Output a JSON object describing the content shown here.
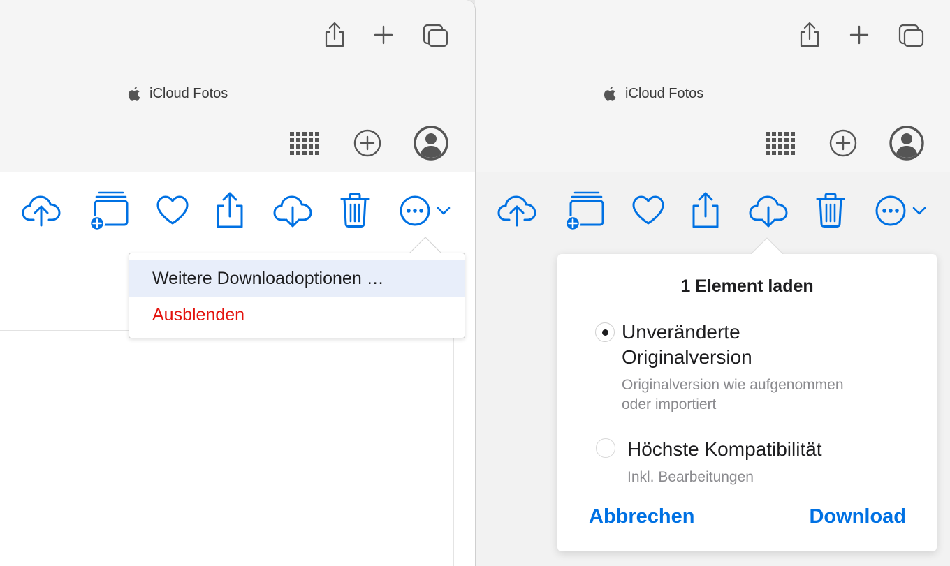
{
  "app": {
    "tab_title": "iCloud Fotos"
  },
  "colors": {
    "accent": "#0071e3",
    "destructive": "#e3130e",
    "icon_gray": "#555555"
  },
  "icons": {
    "titlebar": [
      "share-icon",
      "plus-icon",
      "tabs-overview-icon"
    ],
    "appbar": [
      "app-grid-icon",
      "add-circle-icon",
      "account-avatar-icon"
    ],
    "toolbar": [
      "cloud-upload-icon",
      "add-to-album-icon",
      "heart-icon",
      "share-icon",
      "cloud-download-icon",
      "trash-icon",
      "more-options-icon",
      "chevron-down-icon"
    ]
  },
  "more_menu": {
    "items": [
      {
        "label": "Weitere Downloadoptionen …"
      },
      {
        "label": "Ausblenden"
      }
    ]
  },
  "download_dialog": {
    "title": "1 Element laden",
    "options": [
      {
        "label_line1": "Unveränderte",
        "label_line2": "Originalversion",
        "description_line1": "Originalversion wie aufgenommen",
        "description_line2": "oder importiert",
        "selected": true
      },
      {
        "label_line1": "Höchste Kompatibilität",
        "description_line1": "Inkl. Bearbeitungen",
        "selected": false
      }
    ],
    "cancel_label": "Abbrechen",
    "download_label": "Download"
  }
}
